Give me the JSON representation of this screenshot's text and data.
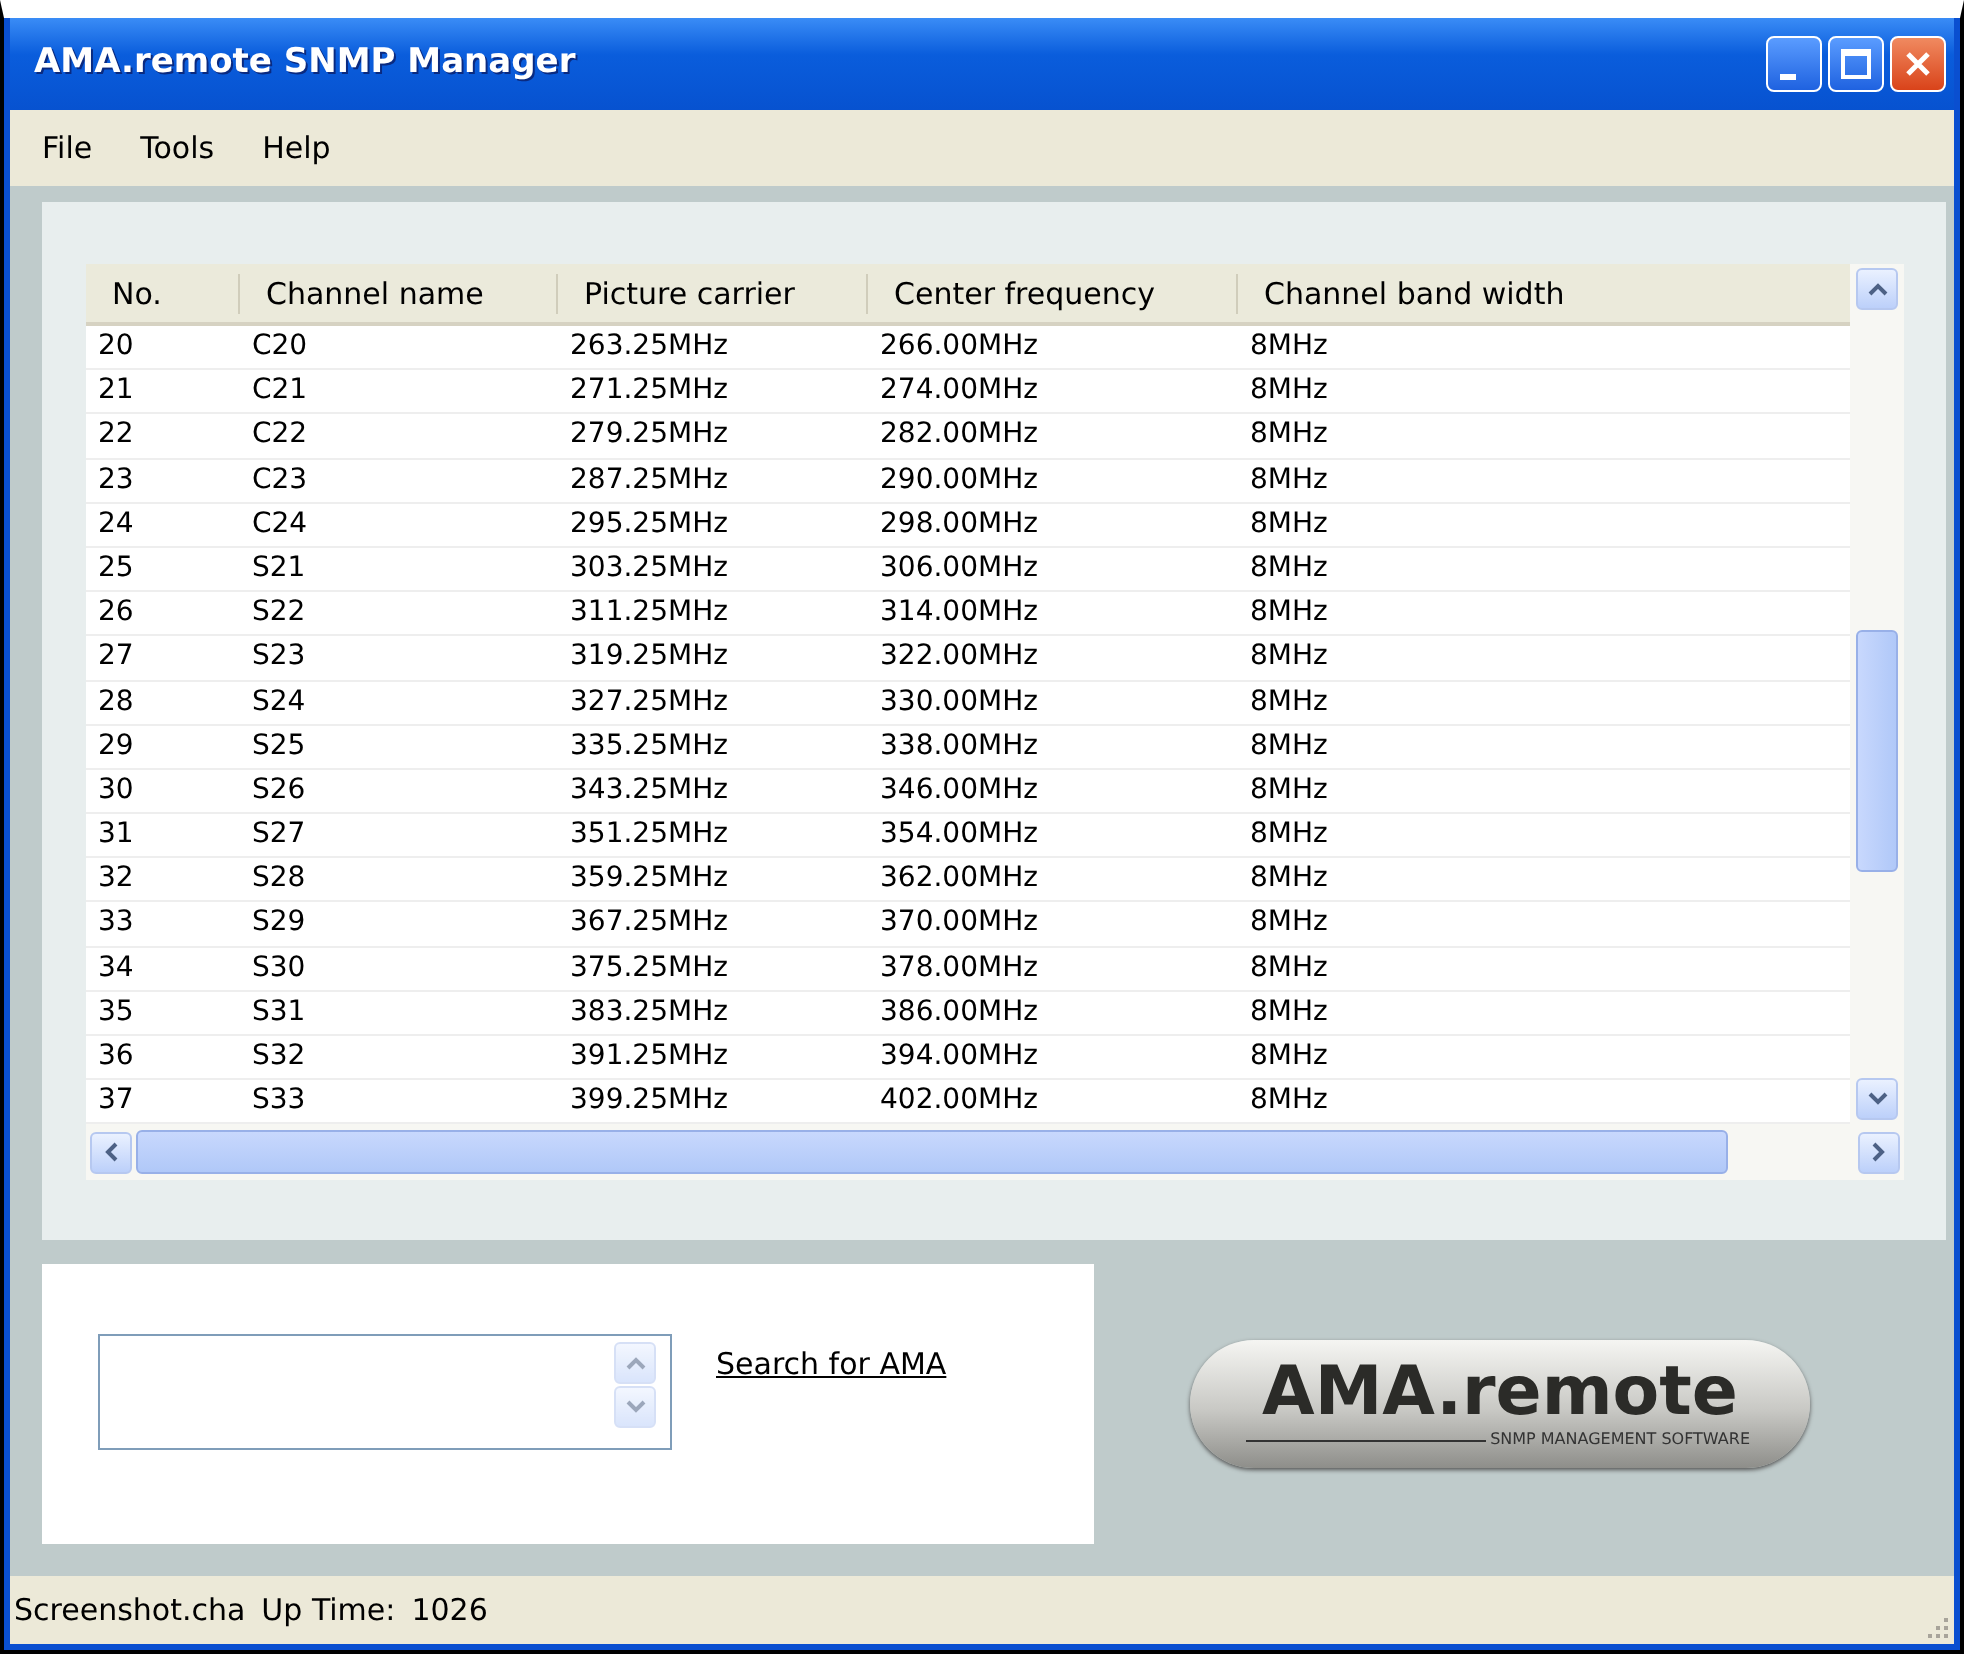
{
  "window": {
    "title": "AMA.remote SNMP Manager",
    "controls": [
      {
        "kind": "minimize"
      },
      {
        "kind": "maximize"
      },
      {
        "kind": "close"
      }
    ]
  },
  "menu": [
    "File",
    "Tools",
    "Help"
  ],
  "table": {
    "columns": [
      "No.",
      "Channel name",
      "Picture carrier",
      "Center frequency",
      "Channel band width"
    ],
    "rows": [
      [
        "20",
        "C20",
        "263.25MHz",
        "266.00MHz",
        "8MHz"
      ],
      [
        "21",
        "C21",
        "271.25MHz",
        "274.00MHz",
        "8MHz"
      ],
      [
        "22",
        "C22",
        "279.25MHz",
        "282.00MHz",
        "8MHz"
      ],
      [
        "23",
        "C23",
        "287.25MHz",
        "290.00MHz",
        "8MHz"
      ],
      [
        "24",
        "C24",
        "295.25MHz",
        "298.00MHz",
        "8MHz"
      ],
      [
        "25",
        "S21",
        "303.25MHz",
        "306.00MHz",
        "8MHz"
      ],
      [
        "26",
        "S22",
        "311.25MHz",
        "314.00MHz",
        "8MHz"
      ],
      [
        "27",
        "S23",
        "319.25MHz",
        "322.00MHz",
        "8MHz"
      ],
      [
        "28",
        "S24",
        "327.25MHz",
        "330.00MHz",
        "8MHz"
      ],
      [
        "29",
        "S25",
        "335.25MHz",
        "338.00MHz",
        "8MHz"
      ],
      [
        "30",
        "S26",
        "343.25MHz",
        "346.00MHz",
        "8MHz"
      ],
      [
        "31",
        "S27",
        "351.25MHz",
        "354.00MHz",
        "8MHz"
      ],
      [
        "32",
        "S28",
        "359.25MHz",
        "362.00MHz",
        "8MHz"
      ],
      [
        "33",
        "S29",
        "367.25MHz",
        "370.00MHz",
        "8MHz"
      ],
      [
        "34",
        "S30",
        "375.25MHz",
        "378.00MHz",
        "8MHz"
      ],
      [
        "35",
        "S31",
        "383.25MHz",
        "386.00MHz",
        "8MHz"
      ],
      [
        "36",
        "S32",
        "391.25MHz",
        "394.00MHz",
        "8MHz"
      ],
      [
        "37",
        "S33",
        "399.25MHz",
        "402.00MHz",
        "8MHz"
      ]
    ]
  },
  "search": {
    "link": "Search for AMA"
  },
  "logo": {
    "title": "AMA.remote",
    "tagline": "SNMP MANAGEMENT SOFTWARE"
  },
  "status_bar": {
    "file": "Screenshot.cha",
    "uptime_label": "Up Time:",
    "uptime": "1026"
  }
}
